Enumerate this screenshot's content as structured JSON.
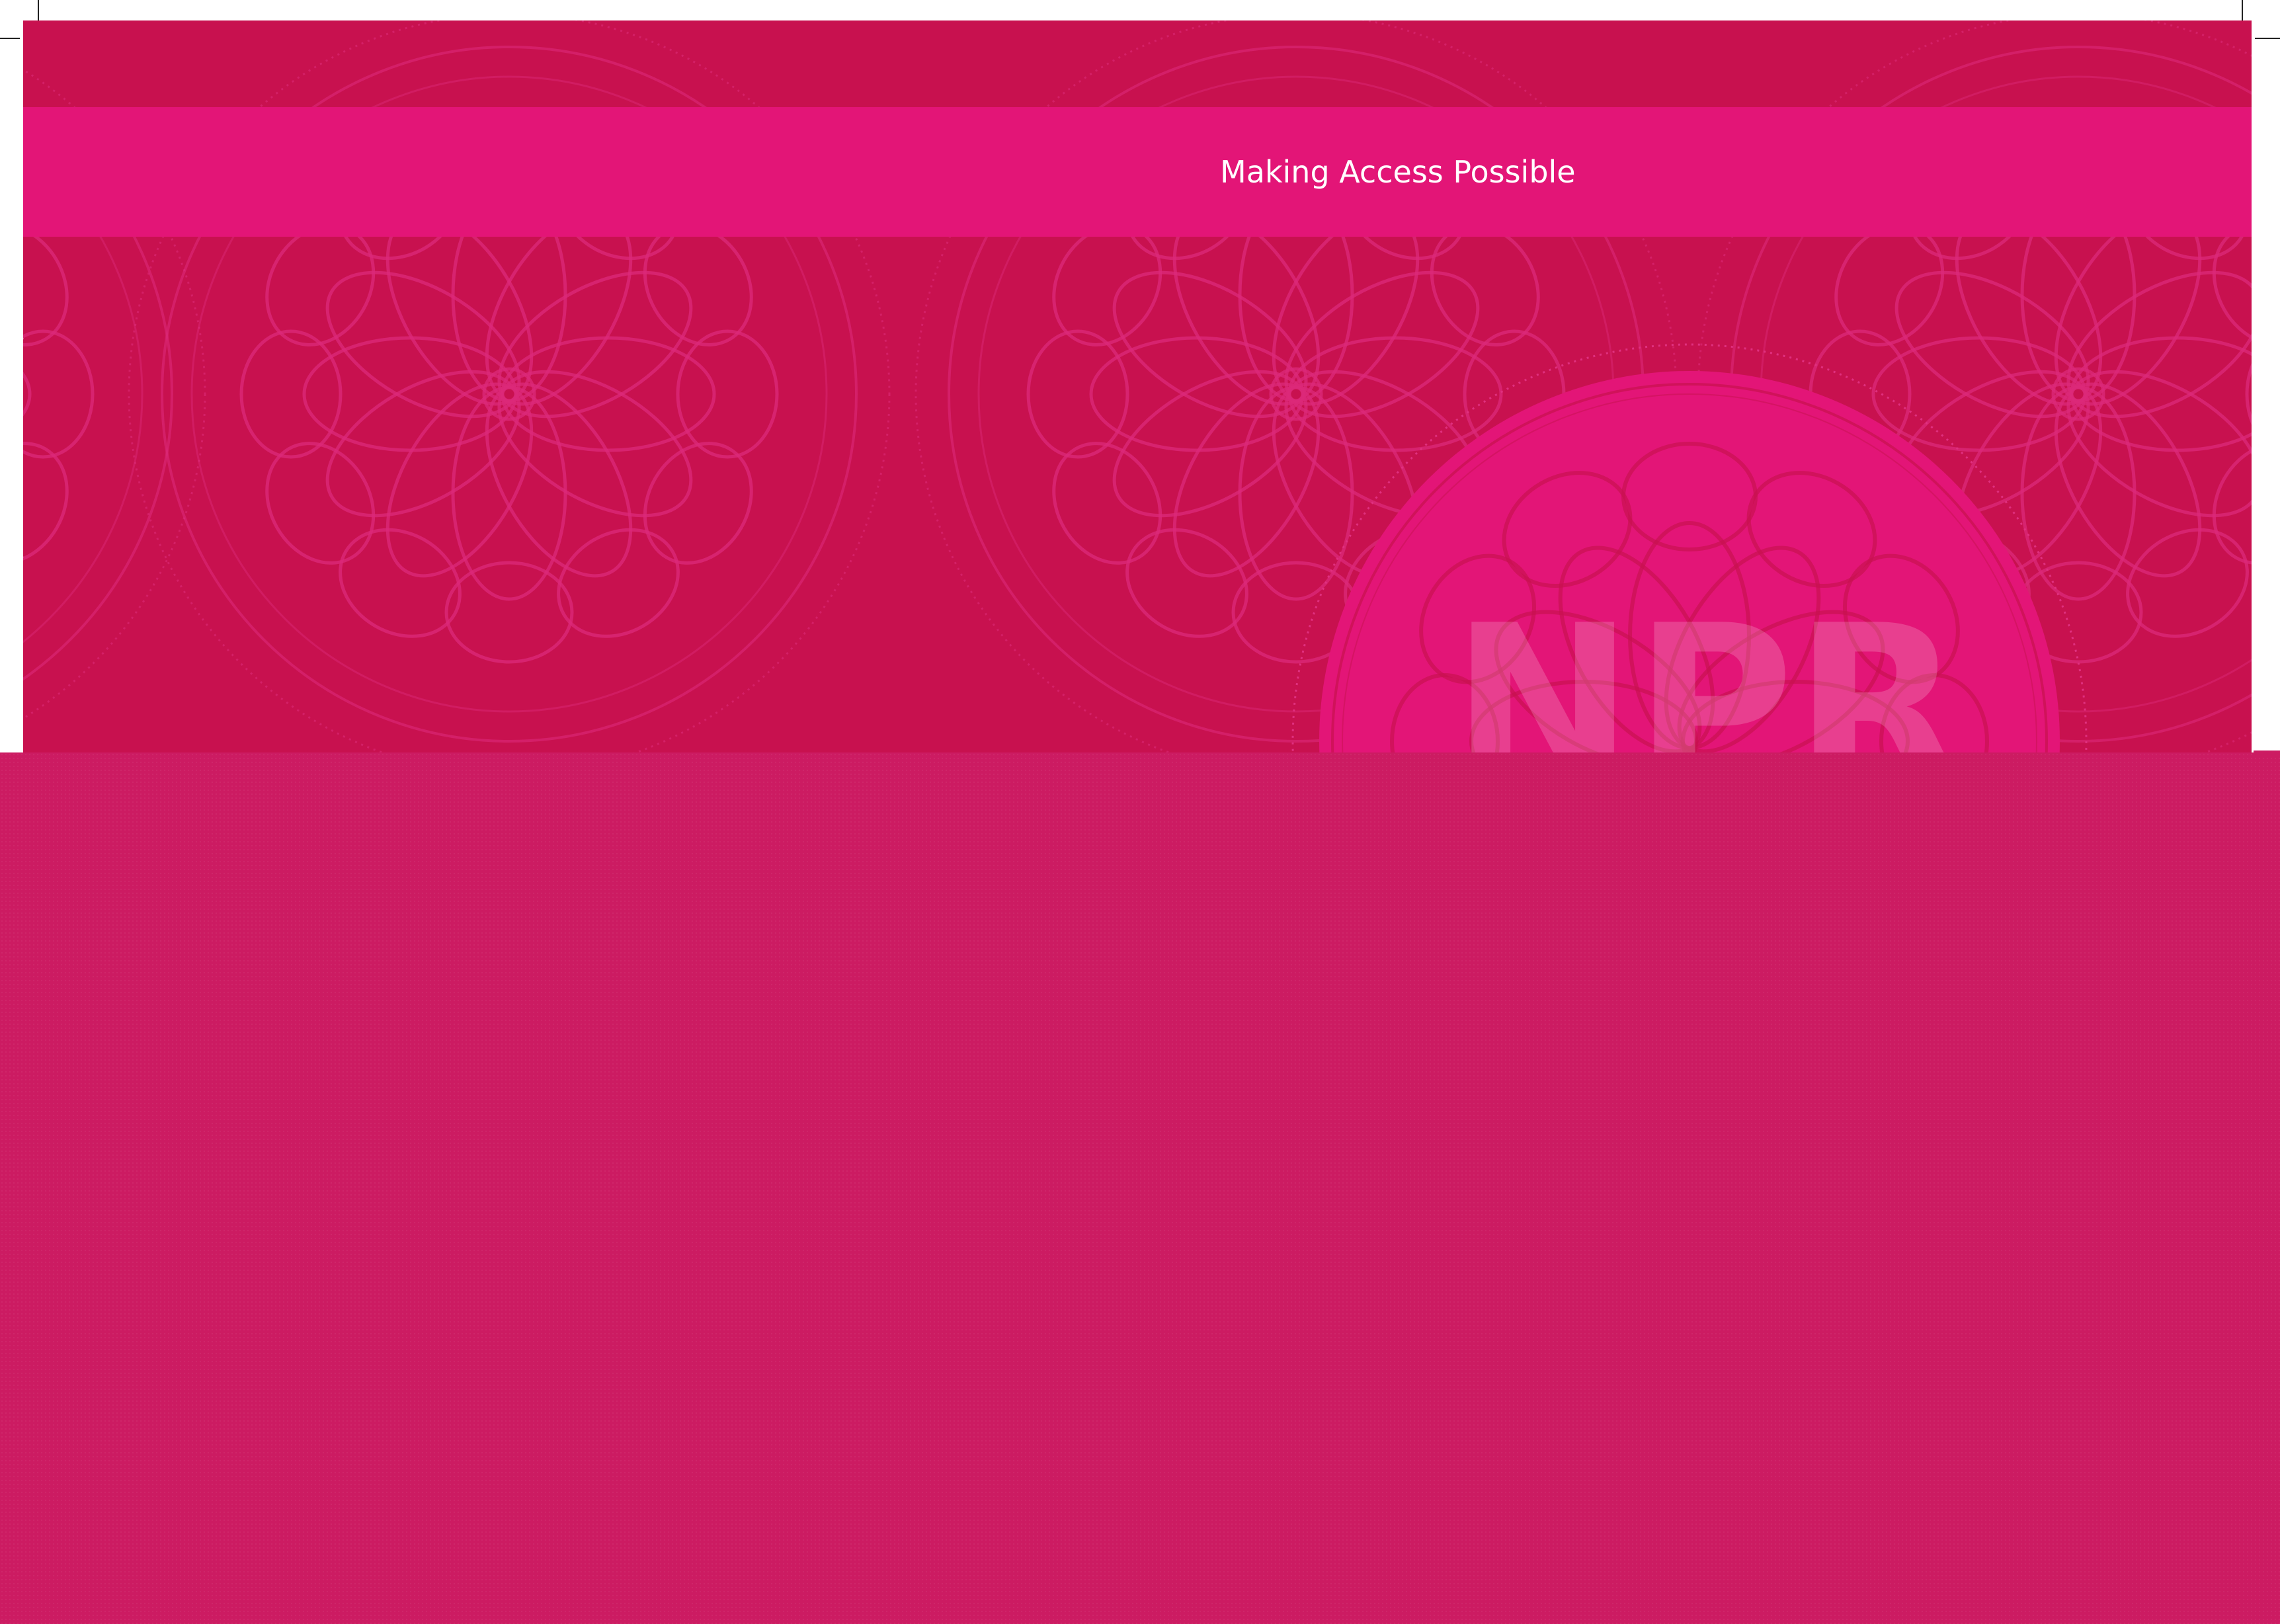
{
  "cover": {
    "tagline": "Making Access Possible",
    "watermark_text": "NPR"
  },
  "colors": {
    "background": "#c8114f",
    "band": "#e31577",
    "overlay": "#cc1b62",
    "ornament_line": "#dc2a7a",
    "medallion_fill": "#e31577",
    "tagline_text": "#ffffff"
  },
  "icons": [
    "rosette-ornament",
    "medallion-emblem",
    "crop-marks"
  ]
}
